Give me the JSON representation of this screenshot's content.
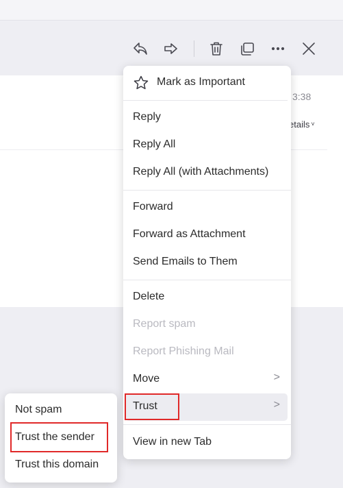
{
  "toolbar": {
    "icons": [
      "reply-icon",
      "forward-icon",
      "trash-icon",
      "copy-icon",
      "more-icon",
      "close-icon"
    ]
  },
  "mail": {
    "time": "3:38",
    "details_label": "etails",
    "details_chevron": "˅"
  },
  "menu": {
    "mark_important": "Mark as Important",
    "reply": "Reply",
    "reply_all": "Reply All",
    "reply_all_attachments": "Reply All (with Attachments)",
    "forward": "Forward",
    "forward_as_attachment": "Forward as Attachment",
    "send_emails": "Send Emails to Them",
    "delete": "Delete",
    "report_spam": "Report spam",
    "report_phishing": "Report Phishing Mail",
    "move": "Move",
    "trust": "Trust",
    "view_new_tab": "View in new Tab",
    "chevron": ">"
  },
  "submenu": {
    "not_spam": "Not spam",
    "trust_sender": "Trust the sender",
    "trust_domain": "Trust this domain"
  },
  "colors": {
    "highlight_border": "#e02828",
    "disabled_text": "#b9b9c0",
    "hover_bg": "#ececf1"
  }
}
